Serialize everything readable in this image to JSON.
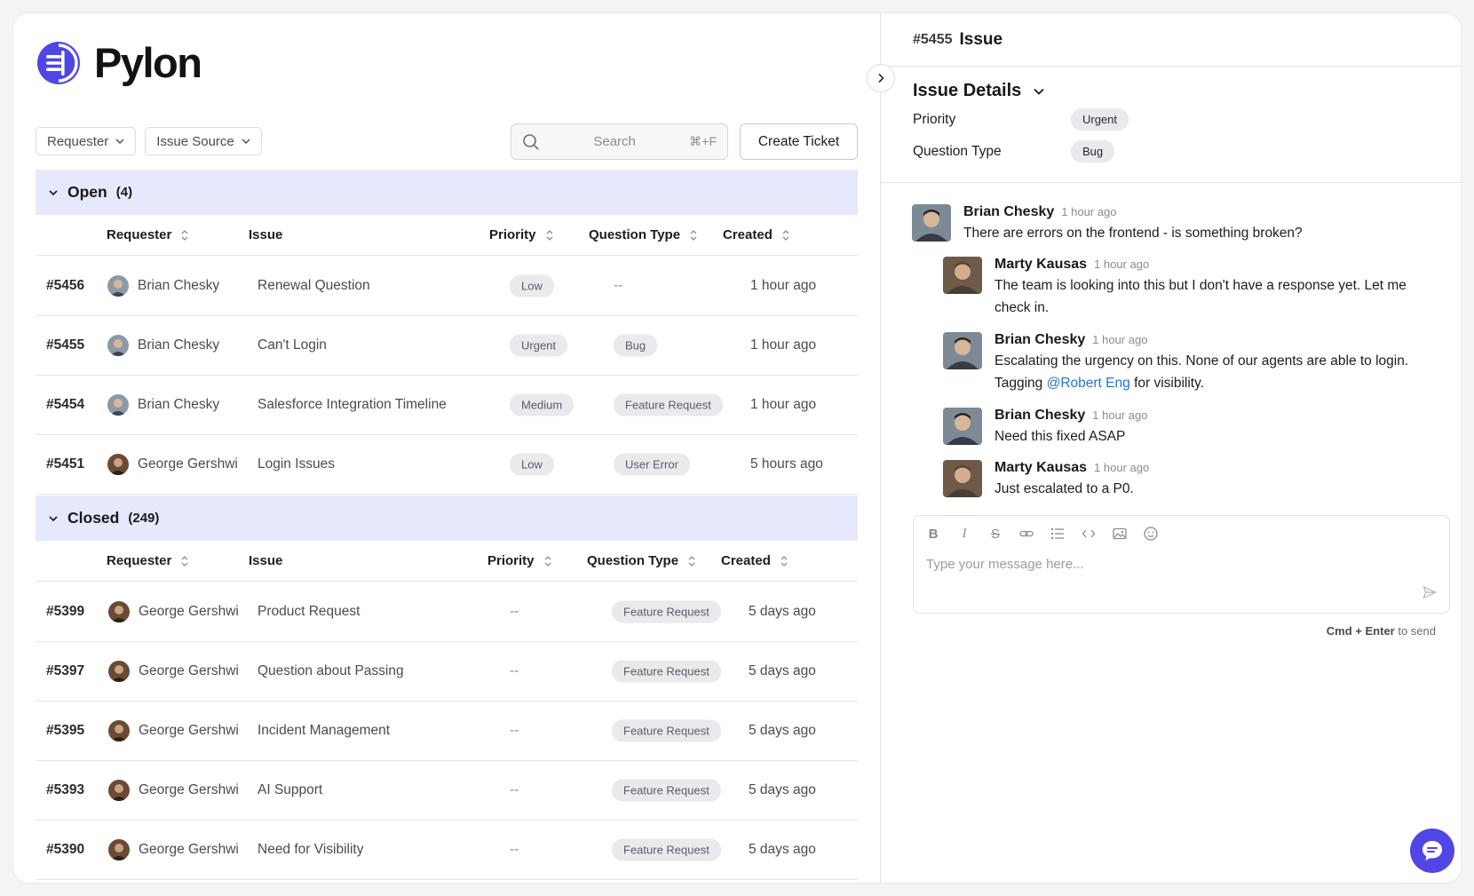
{
  "brand": {
    "name": "Pylon",
    "accent": "#4f46e5"
  },
  "filters": [
    {
      "label": "Requester"
    },
    {
      "label": "Issue Source"
    }
  ],
  "search": {
    "placeholder": "Search",
    "shortcut": "⌘+F"
  },
  "create_ticket_label": "Create Ticket",
  "columns": {
    "requester": "Requester",
    "issue": "Issue",
    "priority": "Priority",
    "question_type": "Question Type",
    "created": "Created"
  },
  "open_group": {
    "label": "Open",
    "count": "(4)",
    "rows": [
      {
        "id": "#5456",
        "requester": "Brian Chesky",
        "issue": "Renewal Question",
        "priority": "Low",
        "question_type": "--",
        "created": "1 hour ago"
      },
      {
        "id": "#5455",
        "requester": "Brian Chesky",
        "issue": "Can't Login",
        "priority": "Urgent",
        "question_type": "Bug",
        "created": "1 hour ago"
      },
      {
        "id": "#5454",
        "requester": "Brian Chesky",
        "issue": "Salesforce Integration Timeline",
        "priority": "Medium",
        "question_type": "Feature Request",
        "created": "1 hour ago"
      },
      {
        "id": "#5451",
        "requester": "George Gershwi",
        "issue": "Login Issues",
        "priority": "Low",
        "question_type": "User Error",
        "created": "5 hours ago"
      }
    ]
  },
  "closed_group": {
    "label": "Closed",
    "count": "(249)",
    "rows": [
      {
        "id": "#5399",
        "requester": "George Gershwi",
        "issue": "Product Request",
        "priority": "--",
        "question_type": "Feature Request",
        "created": "5 days ago"
      },
      {
        "id": "#5397",
        "requester": "George Gershwi",
        "issue": "Question about Passing",
        "priority": "--",
        "question_type": "Feature Request",
        "created": "5 days ago"
      },
      {
        "id": "#5395",
        "requester": "George Gershwi",
        "issue": "Incident Management",
        "priority": "--",
        "question_type": "Feature Request",
        "created": "5 days ago"
      },
      {
        "id": "#5393",
        "requester": "George Gershwi",
        "issue": "AI Support",
        "priority": "--",
        "question_type": "Feature Request",
        "created": "5 days ago"
      },
      {
        "id": "#5390",
        "requester": "George Gershwi",
        "issue": "Need for Visibility",
        "priority": "--",
        "question_type": "Feature Request",
        "created": "5 days ago"
      }
    ]
  },
  "ticket": {
    "id": "#5455",
    "title": "Issue",
    "details_title": "Issue Details",
    "priority_label": "Priority",
    "priority_value": "Urgent",
    "question_type_label": "Question Type",
    "question_type_value": "Bug"
  },
  "messages": [
    {
      "name": "Brian Chesky",
      "time": "1 hour ago",
      "text": "There are errors on the frontend - is something broken?"
    },
    {
      "name": "Marty Kausas",
      "time": "1 hour ago",
      "text": "The team is looking into this but I don't have a response yet. Let me check in."
    },
    {
      "name": "Brian Chesky",
      "time": "1 hour ago",
      "text_before": "Escalating the urgency on this. None of our agents are able to login. Tagging ",
      "mention": "@Robert Eng",
      "text_after": " for visibility."
    },
    {
      "name": "Brian Chesky",
      "time": "1 hour ago",
      "text": "Need this fixed ASAP"
    },
    {
      "name": "Marty Kausas",
      "time": "1 hour ago",
      "text": "Just escalated to a P0."
    }
  ],
  "composer": {
    "placeholder": "Type your message here...",
    "hint_keys": "Cmd + Enter",
    "hint_text": " to send",
    "tools": [
      "bold-icon",
      "italic-icon",
      "strikethrough-icon",
      "link-icon",
      "list-icon",
      "code-icon",
      "image-icon",
      "emoji-icon"
    ]
  }
}
